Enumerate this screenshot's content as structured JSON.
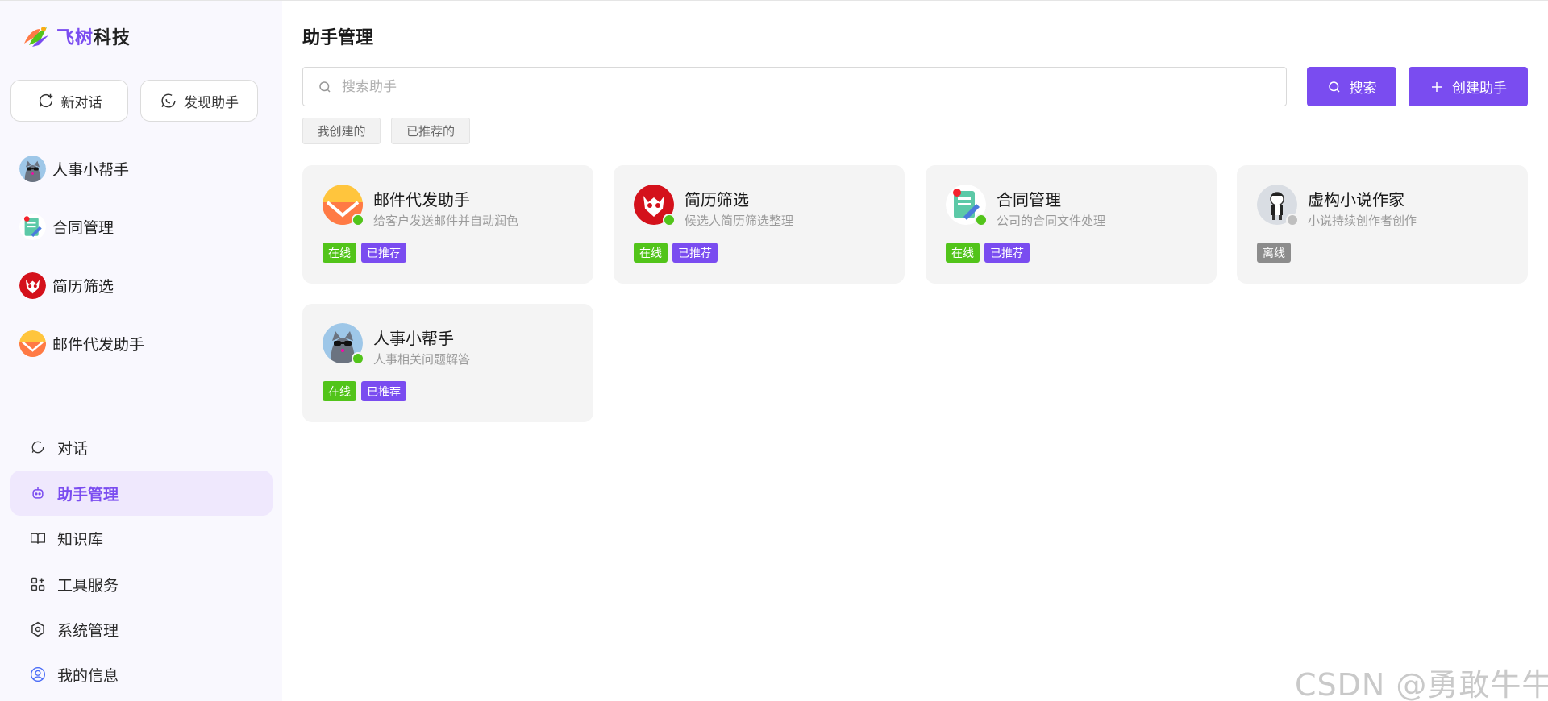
{
  "brand": {
    "name_part1": "飞树",
    "name_part2": "科技"
  },
  "sidebar": {
    "new_chat": "新对话",
    "discover": "发现助手",
    "recent": [
      {
        "label": "人事小帮手",
        "avatar": "cat-avatar"
      },
      {
        "label": "合同管理",
        "avatar": "contract-avatar"
      },
      {
        "label": "简历筛选",
        "avatar": "resume-avatar"
      },
      {
        "label": "邮件代发助手",
        "avatar": "mail-avatar"
      }
    ],
    "nav": [
      {
        "label": "对话",
        "icon": "chat-icon",
        "active": false
      },
      {
        "label": "助手管理",
        "icon": "robot-icon",
        "active": true
      },
      {
        "label": "知识库",
        "icon": "book-icon",
        "active": false
      },
      {
        "label": "工具服务",
        "icon": "apps-icon",
        "active": false
      },
      {
        "label": "系统管理",
        "icon": "settings-icon",
        "active": false
      },
      {
        "label": "我的信息",
        "icon": "user-icon",
        "active": false
      }
    ]
  },
  "main": {
    "title": "助手管理",
    "search_placeholder": "搜索助手",
    "search_button": "搜索",
    "create_button": "创建助手",
    "filters": [
      "我创建的",
      "已推荐的"
    ],
    "cards": [
      {
        "name": "邮件代发助手",
        "desc": "给客户发送邮件并自动润色",
        "status": "在线",
        "online": true,
        "recommended": "已推荐",
        "avatar": "mail-avatar"
      },
      {
        "name": "简历筛选",
        "desc": "候选人简历筛选整理",
        "status": "在线",
        "online": true,
        "recommended": "已推荐",
        "avatar": "resume-avatar"
      },
      {
        "name": "合同管理",
        "desc": "公司的合同文件处理",
        "status": "在线",
        "online": true,
        "recommended": "已推荐",
        "avatar": "contract-avatar"
      },
      {
        "name": "虚构小说作家",
        "desc": "小说持续创作者创作",
        "status": "离线",
        "online": false,
        "recommended": "",
        "avatar": "writer-avatar"
      },
      {
        "name": "人事小帮手",
        "desc": "人事相关问题解答",
        "status": "在线",
        "online": true,
        "recommended": "已推荐",
        "avatar": "cat-avatar"
      }
    ]
  },
  "colors": {
    "accent": "#7a4cf0",
    "online": "#52c41a",
    "offline": "#8c8c8c"
  },
  "watermark": "CSDN @勇敢牛牛_"
}
